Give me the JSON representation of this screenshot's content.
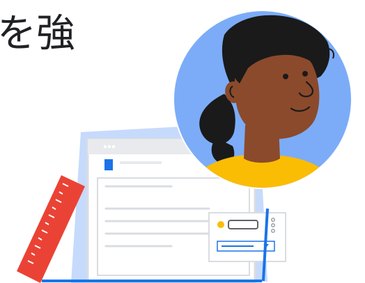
{
  "hero": {
    "headline_fragment": "を強"
  },
  "illustration": {
    "avatar_bg": "#7cacf8",
    "skin": "#8b4a2b",
    "hair": "#1a1a1a",
    "shirt": "#fbbc04",
    "ruler": "#ea4335",
    "accent_blue": "#1a73e8",
    "panel_blue": "#aecbfa",
    "dot_yellow": "#fbbc04"
  }
}
